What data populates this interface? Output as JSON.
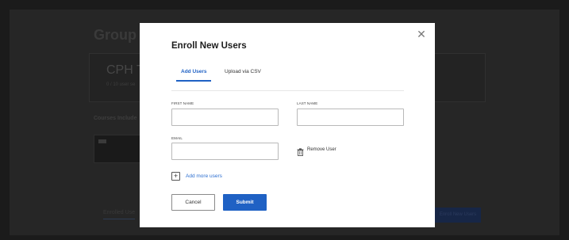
{
  "background": {
    "page_title": "Group",
    "card_title": "CPH T",
    "card_subtitle": "0 / 10 user se",
    "courses_heading": "Courses Include",
    "tab_enrolled": "Enrolled Use",
    "enroll_button": "Enroll New Users"
  },
  "modal": {
    "title": "Enroll New Users",
    "close_icon": "close-icon",
    "tabs": [
      {
        "label": "Add Users",
        "active": true
      },
      {
        "label": "Upload via CSV",
        "active": false
      }
    ],
    "fields": {
      "first_name_label": "FIRST NAME",
      "first_name_value": "",
      "last_name_label": "LAST NAME",
      "last_name_value": "",
      "email_label": "EMAIL",
      "email_value": ""
    },
    "remove_user_label": "Remove User",
    "add_more_label": "Add more users",
    "cancel_label": "Cancel",
    "submit_label": "Submit"
  },
  "colors": {
    "accent": "#1f61c4",
    "overlay": "#1b1b1b"
  }
}
